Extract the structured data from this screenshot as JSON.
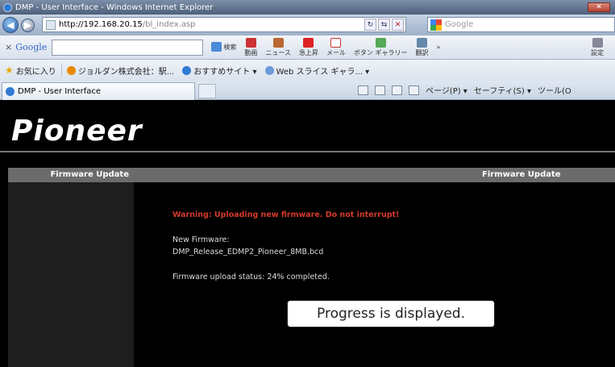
{
  "window": {
    "title": "DMP - User Interface - Windows Internet Explorer"
  },
  "address": {
    "url_host": "http://192.168.20.15",
    "url_path": "/bl_index.asp",
    "search_engine": "Google"
  },
  "toolbar": {
    "google_label": "Google",
    "items": [
      "検索",
      "動画",
      "ニュース",
      "急上昇",
      "メール",
      "ボタン ギャラリー",
      "翻訳",
      "»",
      "設定"
    ]
  },
  "favorites": {
    "label": "お気に入り",
    "items": [
      "ジョルダン株式会社：駅...",
      "おすすめサイト ▾",
      "Web スライス ギャラ... ▾"
    ]
  },
  "tab": {
    "title": "DMP - User Interface"
  },
  "command_bar": {
    "items": [
      "ページ(P) ▾",
      "セーフティ(S) ▾",
      "ツール(O"
    ]
  },
  "page": {
    "logo": "Pioneer",
    "sidebar_title": "Firmware Update",
    "main_title": "Firmware Update",
    "warning": "Warning: Uploading new firmware. Do not interrupt!",
    "new_firmware_label": "New Firmware:",
    "firmware_file": "DMP_Release_EDMP2_Pioneer_8MB.bcd",
    "upload_status": "Firmware upload status: 24% completed.",
    "upload_progress_percent": 24
  },
  "callout": {
    "text": "Progress is displayed."
  },
  "colors": {
    "warning": "#d43a2a",
    "page_background": "#000000",
    "header_bar": "#6b6b6b"
  }
}
